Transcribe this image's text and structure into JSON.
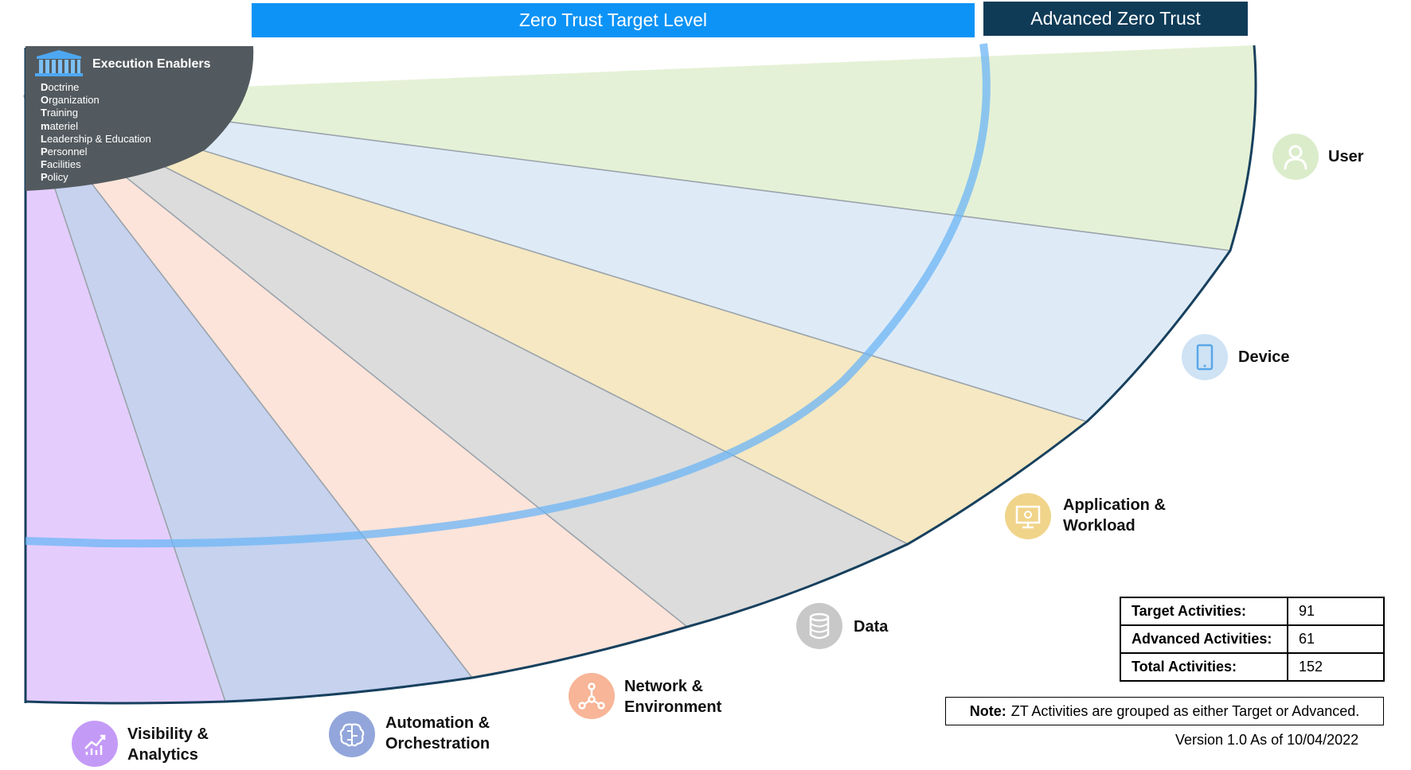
{
  "header": {
    "target_level": "Zero Trust Target Level",
    "advanced": "Advanced Zero Trust"
  },
  "enablers": {
    "title": "Execution  Enablers",
    "items": [
      {
        "first": "D",
        "rest": "octrine"
      },
      {
        "first": "O",
        "rest": "rganization"
      },
      {
        "first": "T",
        "rest": "raining"
      },
      {
        "first": "m",
        "rest": "ateriel"
      },
      {
        "first": "L",
        "rest": "eadership & Education"
      },
      {
        "first": "P",
        "rest": "ersonnel"
      },
      {
        "first": "F",
        "rest": "acilities"
      },
      {
        "first": "P",
        "rest": "olicy"
      }
    ]
  },
  "pillars": [
    {
      "label": "User",
      "icon": "user-icon",
      "color": "#e5f1d6"
    },
    {
      "label": "Device",
      "icon": "tablet-icon",
      "color": "#deebf7"
    },
    {
      "label": "Application &\nWorkload",
      "icon": "monitor-gear-icon",
      "color": "#f5e8c2"
    },
    {
      "label": "Data",
      "icon": "database-icon",
      "color": "#dcdcdc"
    },
    {
      "label": "Network &\nEnvironment",
      "icon": "network-icon",
      "color": "#fde4da"
    },
    {
      "label": "Automation &\nOrchestration",
      "icon": "brain-icon",
      "color": "#c6d2ee"
    },
    {
      "label": "Visibility &\nAnalytics",
      "icon": "analytics-chart-icon",
      "color": "#e4cdfd"
    }
  ],
  "stats": {
    "rows": [
      {
        "label": "Target Activities:",
        "value": "91"
      },
      {
        "label": "Advanced Activities:",
        "value": "61"
      },
      {
        "label": "Total Activities:",
        "value": "152"
      }
    ]
  },
  "note": {
    "prefix": "Note:",
    "text": "ZT Activities are grouped as either Target or Advanced."
  },
  "version": "Version 1.0 As of 10/04/2022"
}
